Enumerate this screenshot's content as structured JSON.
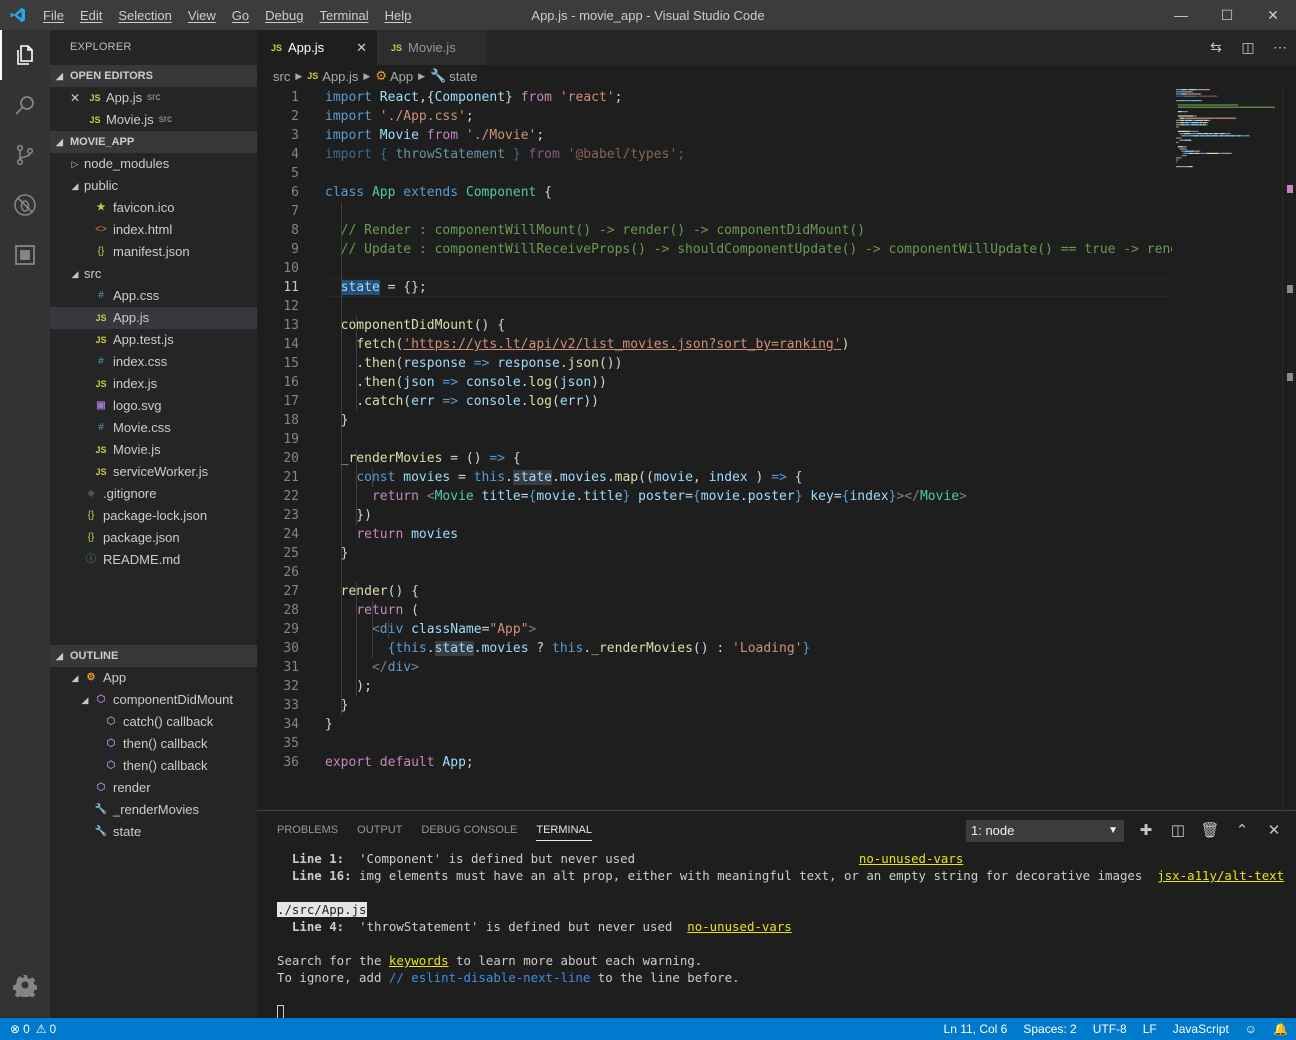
{
  "window": {
    "title": "App.js - movie_app - Visual Studio Code",
    "menu": [
      "File",
      "Edit",
      "Selection",
      "View",
      "Go",
      "Debug",
      "Terminal",
      "Help"
    ],
    "controls": {
      "minimize": "—",
      "maximize": "☐",
      "close": "✕"
    }
  },
  "activity": [
    "files-icon",
    "search-icon",
    "source-control-icon",
    "debug-icon",
    "extensions-icon",
    "gear-icon"
  ],
  "sidebar": {
    "title": "EXPLORER",
    "open_editors": {
      "header": "OPEN EDITORS",
      "items": [
        {
          "icon": "JS",
          "name": "App.js",
          "desc": "src",
          "close": "✕"
        },
        {
          "icon": "JS",
          "name": "Movie.js",
          "desc": "src"
        }
      ]
    },
    "project": {
      "header": "MOVIE_APP",
      "items": [
        {
          "twisty": "›",
          "icon": "",
          "name": "node_modules",
          "indent": 1
        },
        {
          "twisty": "⌄",
          "icon": "",
          "name": "public",
          "indent": 1
        },
        {
          "twisty": "",
          "icon": "★",
          "name": "favicon.ico",
          "indent": 2,
          "kind": "fav"
        },
        {
          "twisty": "",
          "icon": "<>",
          "name": "index.html",
          "indent": 2,
          "kind": "html"
        },
        {
          "twisty": "",
          "icon": "{}",
          "name": "manifest.json",
          "indent": 2,
          "kind": "json"
        },
        {
          "twisty": "⌄",
          "icon": "",
          "name": "src",
          "indent": 1
        },
        {
          "twisty": "",
          "icon": "#",
          "name": "App.css",
          "indent": 2,
          "kind": "css"
        },
        {
          "twisty": "",
          "icon": "JS",
          "name": "App.js",
          "indent": 2,
          "kind": "js",
          "selected": true
        },
        {
          "twisty": "",
          "icon": "JS",
          "name": "App.test.js",
          "indent": 2,
          "kind": "js"
        },
        {
          "twisty": "",
          "icon": "#",
          "name": "index.css",
          "indent": 2,
          "kind": "css"
        },
        {
          "twisty": "",
          "icon": "JS",
          "name": "index.js",
          "indent": 2,
          "kind": "js"
        },
        {
          "twisty": "",
          "icon": "▣",
          "name": "logo.svg",
          "indent": 2,
          "kind": "svg"
        },
        {
          "twisty": "",
          "icon": "#",
          "name": "Movie.css",
          "indent": 2,
          "kind": "css"
        },
        {
          "twisty": "",
          "icon": "JS",
          "name": "Movie.js",
          "indent": 2,
          "kind": "js"
        },
        {
          "twisty": "",
          "icon": "JS",
          "name": "serviceWorker.js",
          "indent": 2,
          "kind": "js"
        },
        {
          "twisty": "",
          "icon": "◆",
          "name": ".gitignore",
          "indent": 1,
          "kind": "git"
        },
        {
          "twisty": "",
          "icon": "{}",
          "name": "package-lock.json",
          "indent": 1,
          "kind": "json"
        },
        {
          "twisty": "",
          "icon": "{}",
          "name": "package.json",
          "indent": 1,
          "kind": "json"
        },
        {
          "twisty": "",
          "icon": "ⓘ",
          "name": "README.md",
          "indent": 1,
          "kind": "md"
        }
      ]
    },
    "outline": {
      "header": "OUTLINE",
      "items": [
        {
          "twisty": "⌄",
          "icon": "⚙",
          "name": "App",
          "indent": 1,
          "kind": "class"
        },
        {
          "twisty": "⌄",
          "icon": "⬡",
          "name": "componentDidMount",
          "indent": 2,
          "kind": "method"
        },
        {
          "twisty": "",
          "icon": "⬡",
          "name": "catch() callback",
          "indent": 3,
          "kind": "method"
        },
        {
          "twisty": "",
          "icon": "⬡",
          "name": "then() callback",
          "indent": 3,
          "kind": "method"
        },
        {
          "twisty": "",
          "icon": "⬡",
          "name": "then() callback",
          "indent": 3,
          "kind": "method"
        },
        {
          "twisty": "",
          "icon": "⬡",
          "name": "render",
          "indent": 2,
          "kind": "method"
        },
        {
          "twisty": "",
          "icon": "🔧",
          "name": "_renderMovies",
          "indent": 2,
          "kind": "prop"
        },
        {
          "twisty": "",
          "icon": "🔧",
          "name": "state",
          "indent": 2,
          "kind": "prop"
        }
      ]
    }
  },
  "tabs": [
    {
      "label": "App.js",
      "active": true,
      "close": "✕"
    },
    {
      "label": "Movie.js",
      "active": false
    }
  ],
  "breadcrumb": [
    "src",
    "App.js",
    "App",
    "state"
  ],
  "editor": {
    "current_line": 11,
    "lines": [
      [
        [
          "k",
          "import"
        ],
        [
          "v",
          " React"
        ],
        [
          "",
          ","
        ],
        [
          "",
          ""
        ],
        [
          "",
          "{"
        ],
        [
          "v",
          "Component"
        ],
        [
          "",
          "}"
        ],
        [
          "kc",
          " from"
        ],
        [
          "s",
          " 'react'"
        ],
        [
          "",
          ";"
        ]
      ],
      [
        [
          "k",
          "import"
        ],
        [
          "s",
          " './App.css'"
        ],
        [
          "",
          ";"
        ]
      ],
      [
        [
          "k",
          "import"
        ],
        [
          "v",
          " Movie"
        ],
        [
          "kc",
          " from"
        ],
        [
          "s",
          " './Movie'"
        ],
        [
          "",
          ";"
        ]
      ],
      [
        [
          "fk",
          "import"
        ],
        [
          "fk",
          " { "
        ],
        [
          "fv",
          "throwStatement"
        ],
        [
          "fk",
          " } "
        ],
        [
          "fk2",
          "from"
        ],
        [
          "fs",
          " '@babel/types'"
        ],
        [
          "fk",
          ";"
        ]
      ],
      [],
      [
        [
          "k",
          "class"
        ],
        [
          "t",
          " App"
        ],
        [
          "k",
          " extends"
        ],
        [
          "t",
          " Component"
        ],
        [
          "",
          " {"
        ]
      ],
      [],
      [
        [
          "",
          "  "
        ],
        [
          "c",
          "// Render : componentWillMount() -> render() -> componentDidMount()"
        ]
      ],
      [
        [
          "",
          "  "
        ],
        [
          "c",
          "// Update : componentWillReceiveProps() -> shouldComponentUpdate() -> componentWillUpdate() == true -> rende"
        ]
      ],
      [],
      [
        [
          "",
          "  "
        ],
        [
          "hlv",
          "state"
        ],
        [
          "",
          " = {};"
        ]
      ],
      [],
      [
        [
          "",
          "  "
        ],
        [
          "f",
          "componentDidMount"
        ],
        [
          "",
          "() {"
        ]
      ],
      [
        [
          "",
          "    "
        ],
        [
          "f",
          "fetch"
        ],
        [
          "",
          "("
        ],
        [
          "su",
          "'https://yts.lt/api/v2/list_movies.json?sort_by=ranking'"
        ],
        [
          "",
          ")"
        ]
      ],
      [
        [
          "",
          "    ."
        ],
        [
          "f",
          "then"
        ],
        [
          "",
          "("
        ],
        [
          "v",
          "response"
        ],
        [
          "k",
          " =>"
        ],
        [
          "v",
          " response"
        ],
        [
          "",
          "."
        ],
        [
          "f",
          "json"
        ],
        [
          "",
          "())"
        ]
      ],
      [
        [
          "",
          "    ."
        ],
        [
          "f",
          "then"
        ],
        [
          "",
          "("
        ],
        [
          "v",
          "json"
        ],
        [
          "k",
          " =>"
        ],
        [
          "v",
          " console"
        ],
        [
          "",
          "."
        ],
        [
          "f",
          "log"
        ],
        [
          "",
          "("
        ],
        [
          "v",
          "json"
        ],
        [
          "",
          "))"
        ]
      ],
      [
        [
          "",
          "    ."
        ],
        [
          "f",
          "catch"
        ],
        [
          "",
          "("
        ],
        [
          "v",
          "err"
        ],
        [
          "k",
          " =>"
        ],
        [
          "v",
          " console"
        ],
        [
          "",
          "."
        ],
        [
          "f",
          "log"
        ],
        [
          "",
          "("
        ],
        [
          "v",
          "err"
        ],
        [
          "",
          "))"
        ]
      ],
      [
        [
          "",
          "  }"
        ]
      ],
      [],
      [
        [
          "",
          "  "
        ],
        [
          "f",
          "_renderMovies"
        ],
        [
          "",
          " = () "
        ],
        [
          "k",
          "=>"
        ],
        [
          "",
          " {"
        ]
      ],
      [
        [
          "",
          "    "
        ],
        [
          "k",
          "const"
        ],
        [
          "v",
          " movies"
        ],
        [
          "",
          " = "
        ],
        [
          "k",
          "this"
        ],
        [
          "",
          "."
        ],
        [
          "wbv",
          "state"
        ],
        [
          "",
          "."
        ],
        [
          "v",
          "movies"
        ],
        [
          "",
          "."
        ],
        [
          "f",
          "map"
        ],
        [
          "",
          "(("
        ],
        [
          "v",
          "movie"
        ],
        [
          "",
          ", "
        ],
        [
          "v",
          "index"
        ],
        [
          "",
          " ) "
        ],
        [
          "k",
          "=>"
        ],
        [
          "",
          " {"
        ]
      ],
      [
        [
          "",
          "      "
        ],
        [
          "kc",
          "return"
        ],
        [
          "g",
          " <"
        ],
        [
          "t",
          "Movie"
        ],
        [
          "v",
          " title"
        ],
        [
          "",
          "="
        ],
        [
          "k",
          "{"
        ],
        [
          "v",
          "movie"
        ],
        [
          "",
          "."
        ],
        [
          "v",
          "title"
        ],
        [
          "k",
          "}"
        ],
        [
          "v",
          " poster"
        ],
        [
          "",
          "="
        ],
        [
          "k",
          "{"
        ],
        [
          "v",
          "movie"
        ],
        [
          "",
          "."
        ],
        [
          "v",
          "poster"
        ],
        [
          "k",
          "}"
        ],
        [
          "v",
          " key"
        ],
        [
          "",
          "="
        ],
        [
          "k",
          "{"
        ],
        [
          "v",
          "index"
        ],
        [
          "k",
          "}"
        ],
        [
          "g",
          "></"
        ],
        [
          "t",
          "Movie"
        ],
        [
          "g",
          ">"
        ]
      ],
      [
        [
          "",
          "    })"
        ]
      ],
      [
        [
          "",
          "    "
        ],
        [
          "kc",
          "return"
        ],
        [
          "v",
          " movies"
        ]
      ],
      [
        [
          "",
          "  }"
        ]
      ],
      [],
      [
        [
          "",
          "  "
        ],
        [
          "f",
          "render"
        ],
        [
          "",
          "() {"
        ]
      ],
      [
        [
          "",
          "    "
        ],
        [
          "kc",
          "return"
        ],
        [
          "",
          " ("
        ]
      ],
      [
        [
          "",
          "      "
        ],
        [
          "g",
          "<"
        ],
        [
          "k",
          "div"
        ],
        [
          "v",
          " className"
        ],
        [
          "",
          "="
        ],
        [
          "s",
          "\"App\""
        ],
        [
          "g",
          ">"
        ]
      ],
      [
        [
          "",
          "        "
        ],
        [
          "k",
          "{this"
        ],
        [
          "",
          "."
        ],
        [
          "wbv",
          "state"
        ],
        [
          "",
          "."
        ],
        [
          "v",
          "movies"
        ],
        [
          "",
          " ? "
        ],
        [
          "k",
          "this"
        ],
        [
          "",
          "."
        ],
        [
          "f",
          "_renderMovies"
        ],
        [
          "",
          "() : "
        ],
        [
          "s",
          "'Loading'"
        ],
        [
          "k",
          "}"
        ]
      ],
      [
        [
          "",
          "      "
        ],
        [
          "g",
          "</"
        ],
        [
          "k",
          "div"
        ],
        [
          "g",
          ">"
        ]
      ],
      [
        [
          "",
          "    );"
        ]
      ],
      [
        [
          "",
          "  }"
        ]
      ],
      [
        [
          "",
          "}"
        ]
      ],
      [],
      [
        [
          "kc",
          "export"
        ],
        [
          "kc",
          " default"
        ],
        [
          "v",
          " App"
        ],
        [
          "",
          ";"
        ]
      ]
    ]
  },
  "panel": {
    "tabs": [
      "PROBLEMS",
      "OUTPUT",
      "DEBUG CONSOLE",
      "TERMINAL"
    ],
    "active_tab": "TERMINAL",
    "terminal_select": "1: node",
    "actions": [
      "add-icon",
      "split-icon",
      "trash-icon",
      "chevron-up-icon",
      "close-icon"
    ],
    "lines": [
      {
        "segs": [
          [
            "b",
            "  Line 1:  "
          ],
          [
            "",
            "'Component' is defined but never used"
          ],
          [
            "pad",
            "                              "
          ],
          [
            "y",
            "no-unused-vars"
          ]
        ]
      },
      {
        "segs": [
          [
            "b",
            "  Line 16: "
          ],
          [
            "",
            "img elements must have an alt prop, either with meaningful text, or an empty string for decorative images  "
          ],
          [
            "y",
            "jsx-a11y/alt-text"
          ]
        ]
      },
      {
        "segs": []
      },
      {
        "segs": [
          [
            "inv",
            "./src/App.js"
          ]
        ]
      },
      {
        "segs": [
          [
            "b",
            "  Line 4:  "
          ],
          [
            "",
            "'throwStatement' is defined but never used  "
          ],
          [
            "y",
            "no-unused-vars"
          ]
        ]
      },
      {
        "segs": []
      },
      {
        "segs": [
          [
            "",
            "Search for the "
          ],
          [
            "y",
            "keywords"
          ],
          [
            "",
            " to learn more about each warning."
          ]
        ]
      },
      {
        "segs": [
          [
            "",
            "To ignore, add "
          ],
          [
            "bl",
            "// eslint-disable-next-line"
          ],
          [
            "",
            " to the line before."
          ]
        ]
      },
      {
        "segs": []
      },
      {
        "segs": [
          [
            "cur",
            ""
          ]
        ]
      }
    ]
  },
  "status": {
    "errors": "0",
    "warnings": "0",
    "position": "Ln 11, Col 6",
    "spaces": "Spaces: 2",
    "encoding": "UTF-8",
    "eol": "LF",
    "language": "JavaScript"
  },
  "colors": {
    "accent": "#007acc",
    "keyword": "#569cd6",
    "string": "#ce9178",
    "comment": "#6a9955"
  }
}
